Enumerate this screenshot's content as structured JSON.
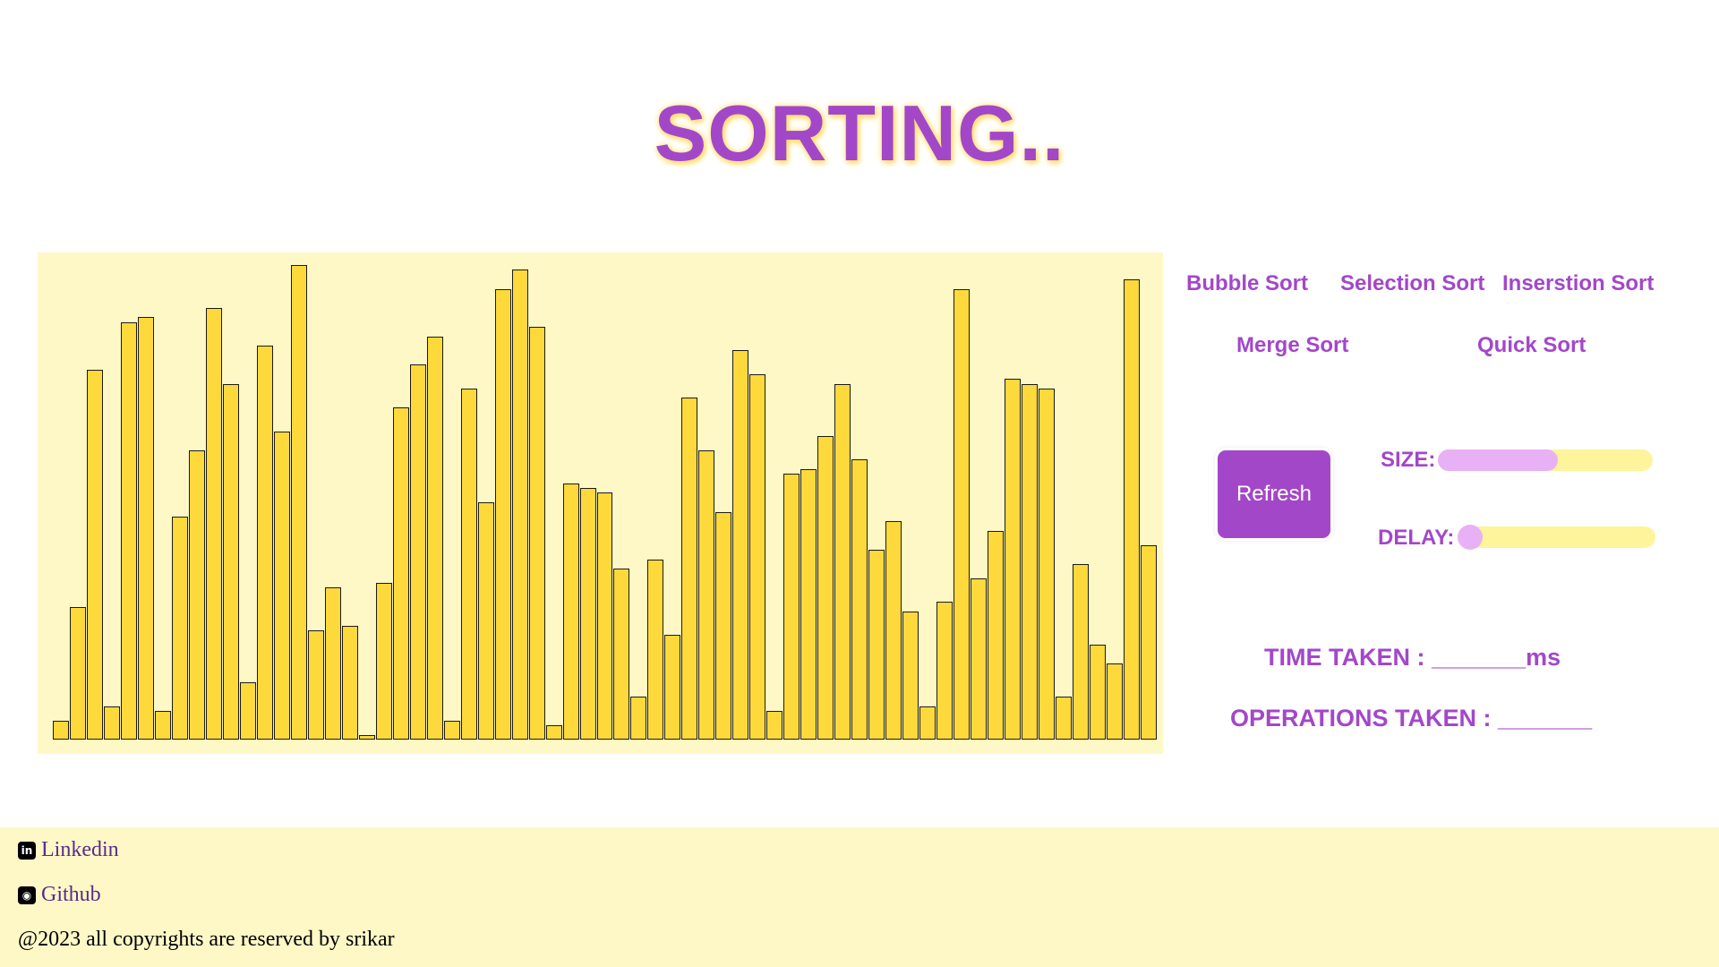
{
  "title": "SORTING..",
  "algorithms": {
    "bubble": "Bubble Sort",
    "selection": "Selection Sort",
    "insertion": "Inserstion Sort",
    "merge": "Merge Sort",
    "quick": "Quick Sort"
  },
  "controls": {
    "refresh_label": "Refresh",
    "size_label": "SIZE:",
    "size_value_fraction": 0.56,
    "delay_label": "DELAY:",
    "delay_value_fraction": 0.0
  },
  "stats": {
    "time_text": "TIME TAKEN : _______ms",
    "ops_text": "OPERATIONS TAKEN : _______"
  },
  "footer": {
    "linkedin": "Linkedin",
    "github": "Github",
    "copyright": "@2023 all copyrights are reserved by srikar"
  },
  "colors": {
    "accent": "#a347c9",
    "bar": "#fed93c",
    "panel": "#fef8c6",
    "slider_track": "#fef49c",
    "slider_fill": "#e8b1f5"
  },
  "chart_data": {
    "type": "bar",
    "values": [
      4,
      28,
      78,
      7,
      88,
      89,
      6,
      47,
      61,
      91,
      75,
      12,
      83,
      65,
      100,
      23,
      32,
      24,
      1,
      33,
      70,
      79,
      85,
      4,
      74,
      50,
      95,
      99,
      87,
      3,
      54,
      53,
      52,
      36,
      9,
      38,
      22,
      72,
      61,
      48,
      82,
      77,
      6,
      56,
      57,
      64,
      75,
      59,
      40,
      46,
      27,
      7,
      29,
      95,
      34,
      44,
      76,
      75,
      74,
      9,
      37,
      20,
      16,
      97,
      41
    ],
    "ylim": [
      0,
      100
    ]
  }
}
